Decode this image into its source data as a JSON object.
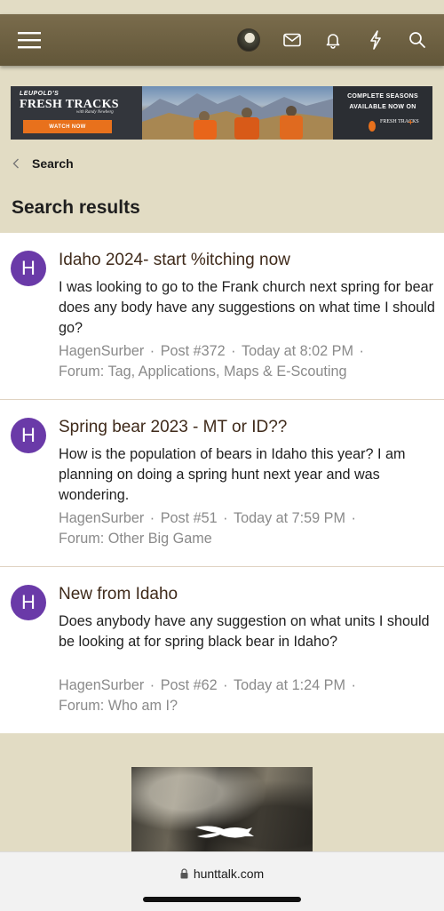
{
  "header": {
    "icons": [
      "menu-icon",
      "user-avatar",
      "envelope-icon",
      "bell-icon",
      "bolt-icon",
      "search-icon"
    ],
    "color": "#6f6244"
  },
  "banner": {
    "brand": "LEUPOLD'S",
    "title": "FRESH TRACKS",
    "with": "with Randy Newberg",
    "cta": "WATCH NOW",
    "right_line1": "COMPLETE SEASONS",
    "right_line2": "AVAILABLE NOW ON",
    "right_logo": "FRESH TRACKS"
  },
  "breadcrumb": {
    "label": "Search"
  },
  "page": {
    "title": "Search results"
  },
  "results": [
    {
      "avatar_letter": "H",
      "title": "Idaho 2024- start %itching now",
      "snippet": "I was looking to go to the Frank church next spring for bear does any body have any suggestions on what time I should go?",
      "author": "HagenSurber",
      "post": "Post #372",
      "time": "Today at 8:02 PM",
      "forum": "Forum: Tag, Applications, Maps & E-Scouting"
    },
    {
      "avatar_letter": "H",
      "title": "Spring bear 2023 - MT or ID??",
      "snippet": "How is the population of bears in Idaho this year? I am planning on doing a spring hunt next year and was wondering.",
      "author": "HagenSurber",
      "post": "Post #51",
      "time": "Today at 7:59 PM",
      "forum": "Forum: Other Big Game"
    },
    {
      "avatar_letter": "H",
      "title": "New from Idaho",
      "snippet": "Does anybody have any suggestion on what units I should be looking at for spring black bear in Idaho?",
      "author": "HagenSurber",
      "post": "Post #62",
      "time": "Today at 1:24 PM",
      "forum": "Forum: Who am I?"
    }
  ],
  "browser": {
    "url": "hunttalk.com"
  },
  "colors": {
    "avatar": "#6a3aa8",
    "page_bg": "#e2dcc4",
    "title_text": "#3f2a1a",
    "meta_text": "#8a8a8a",
    "cta": "#e8711c"
  }
}
